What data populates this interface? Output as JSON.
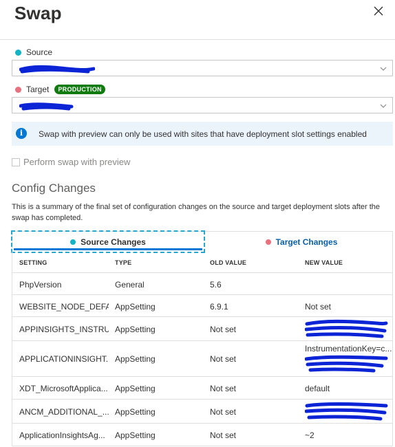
{
  "panel": {
    "title": "Swap",
    "close_icon": "close-icon"
  },
  "source": {
    "label": "Source",
    "dot_color": "#13b3c6"
  },
  "target": {
    "label": "Target",
    "badge": "PRODUCTION",
    "dot_color": "#e8717f",
    "badge_color": "#107c10"
  },
  "info": {
    "icon": "info-icon",
    "text": "Swap with preview can only be used with sites that have deployment slot settings enabled"
  },
  "preview": {
    "label": "Perform swap with preview"
  },
  "config": {
    "title": "Config Changes",
    "description": "This is a summary of the final set of configuration changes on the source and target deployment slots after the swap has completed."
  },
  "tabs": {
    "source": "Source Changes",
    "target": "Target Changes"
  },
  "table": {
    "headers": [
      "SETTING",
      "TYPE",
      "OLD VALUE",
      "NEW VALUE"
    ],
    "rows": [
      {
        "setting": "PhpVersion",
        "type": "General",
        "old": "5.6",
        "new": ""
      },
      {
        "setting": "WEBSITE_NODE_DEFA...",
        "type": "AppSetting",
        "old": "6.9.1",
        "new": "Not set"
      },
      {
        "setting": "APPINSIGHTS_INSTRU...",
        "type": "AppSetting",
        "old": "Not set",
        "new": ""
      },
      {
        "setting": "APPLICATIONINSIGHT...",
        "type": "AppSetting",
        "old": "Not set",
        "new": "InstrumentationKey=c..."
      },
      {
        "setting": "XDT_MicrosoftApplica...",
        "type": "AppSetting",
        "old": "Not set",
        "new": "default"
      },
      {
        "setting": "ANCM_ADDITIONAL_...",
        "type": "AppSetting",
        "old": "Not set",
        "new": ""
      },
      {
        "setting": "ApplicationInsightsAg...",
        "type": "AppSetting",
        "old": "Not set",
        "new": "~2"
      }
    ]
  },
  "redaction_color": "#0a24d6"
}
